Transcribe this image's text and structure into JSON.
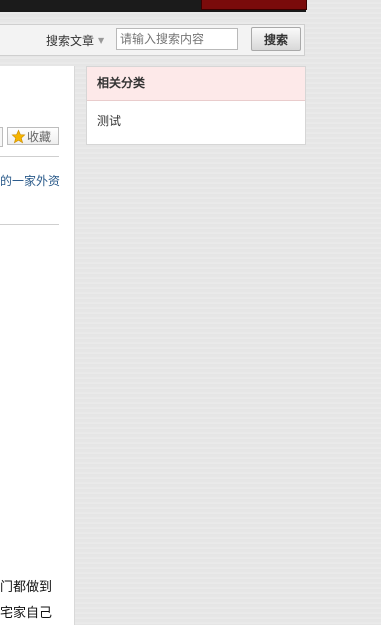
{
  "search": {
    "scope_label": "搜索文章",
    "placeholder": "请输入搜索内容",
    "button_label": "搜索"
  },
  "article": {
    "bookmark_label": "收藏",
    "link_fragment": "的一家外资",
    "text_fragment_1": "门都做到",
    "text_fragment_2": "宅家自己"
  },
  "sidebar": {
    "heading": "相关分类",
    "categories": [
      {
        "label": "测试"
      }
    ]
  },
  "colors": {
    "topbar": "#1b1b1b",
    "topbar_accent": "#7a0b0b",
    "side_header_bg": "#fde9e9",
    "link": "#2a5a8a"
  },
  "icons": {
    "bookmark": "star-icon",
    "scope_dropdown": "chevron-down-icon"
  }
}
